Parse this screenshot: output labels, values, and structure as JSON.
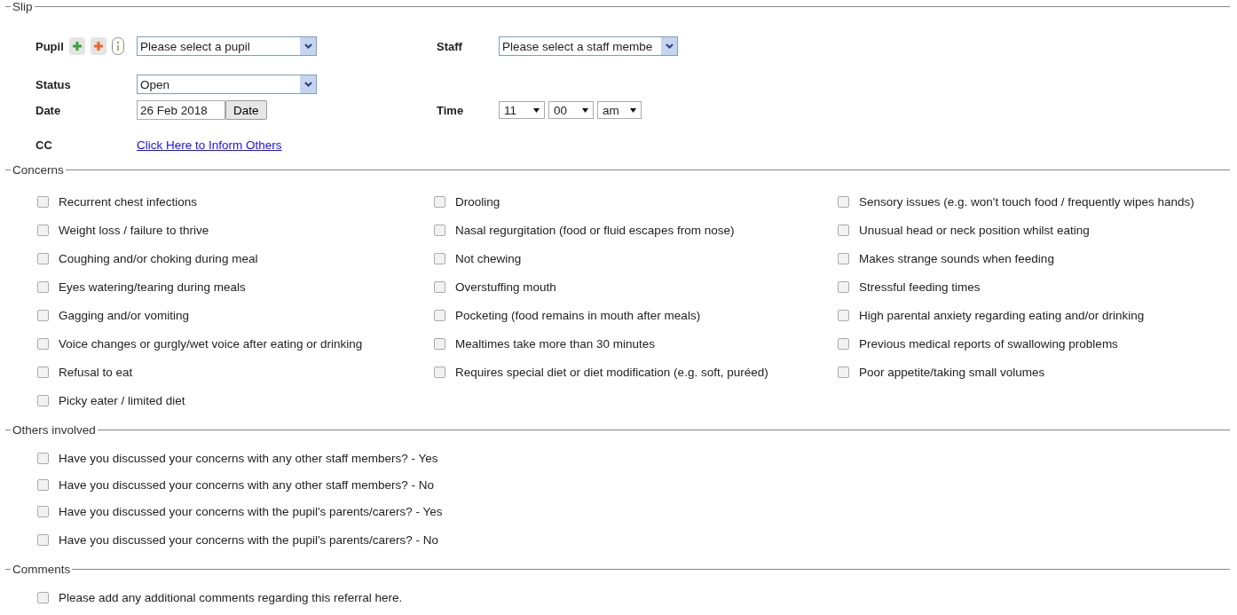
{
  "slip": {
    "legend": "Slip",
    "pupil": {
      "label": "Pupil",
      "value": "Please select a pupil"
    },
    "staff": {
      "label": "Staff",
      "value": "Please select a staff membe"
    },
    "status": {
      "label": "Status",
      "value": "Open"
    },
    "date": {
      "label": "Date",
      "value": "26 Feb 2018",
      "button": "Date"
    },
    "time": {
      "label": "Time",
      "hour": "11",
      "minute": "00",
      "period": "am"
    },
    "cc": {
      "label": "CC",
      "link": "Click Here to Inform Others"
    }
  },
  "concerns": {
    "legend": "Concerns",
    "columns": [
      [
        {
          "label": "Recurrent chest infections",
          "checked": false
        },
        {
          "label": "Weight loss / failure to thrive",
          "checked": false
        },
        {
          "label": "Coughing and/or choking during meal",
          "checked": false
        },
        {
          "label": "Eyes watering/tearing during meals",
          "checked": false
        },
        {
          "label": "Gagging and/or vomiting",
          "checked": false
        },
        {
          "label": "Voice changes or gurgly/wet voice after eating or drinking",
          "checked": false
        },
        {
          "label": "Refusal to eat",
          "checked": false
        },
        {
          "label": "Picky eater / limited diet",
          "checked": false
        }
      ],
      [
        {
          "label": "Drooling",
          "checked": false
        },
        {
          "label": "Nasal regurgitation (food or fluid escapes from nose)",
          "checked": false
        },
        {
          "label": "Not chewing",
          "checked": false
        },
        {
          "label": "Overstuffing mouth",
          "checked": false
        },
        {
          "label": "Pocketing (food remains in mouth after meals)",
          "checked": false
        },
        {
          "label": "Mealtimes take more than 30 minutes",
          "checked": false
        },
        {
          "label": "Requires special diet or diet modification (e.g. soft, puréed)",
          "checked": false
        }
      ],
      [
        {
          "label": "Sensory issues (e.g. won't touch food / frequently wipes hands)",
          "checked": false
        },
        {
          "label": "Unusual head or neck position whilst eating",
          "checked": false
        },
        {
          "label": "Makes strange sounds when feeding",
          "checked": false
        },
        {
          "label": "Stressful feeding times",
          "checked": false
        },
        {
          "label": "High parental anxiety regarding eating and/or drinking",
          "checked": false
        },
        {
          "label": "Previous medical reports of swallowing problems",
          "checked": false
        },
        {
          "label": "Poor appetite/taking small volumes",
          "checked": false
        }
      ]
    ]
  },
  "others_involved": {
    "legend": "Others involved",
    "items": [
      {
        "label": "Have you discussed your concerns with any other staff members? - Yes",
        "checked": false
      },
      {
        "label": "Have you discussed your concerns with any other staff members? - No",
        "checked": false
      },
      {
        "label": "Have you discussed your concerns with the pupil's parents/carers? - Yes",
        "checked": false
      },
      {
        "label": "Have you discussed your concerns with the pupil's parents/carers? - No",
        "checked": false
      }
    ]
  },
  "comments": {
    "legend": "Comments",
    "items": [
      {
        "label": "Please add any additional comments regarding this referral here.",
        "checked": false
      }
    ]
  }
}
